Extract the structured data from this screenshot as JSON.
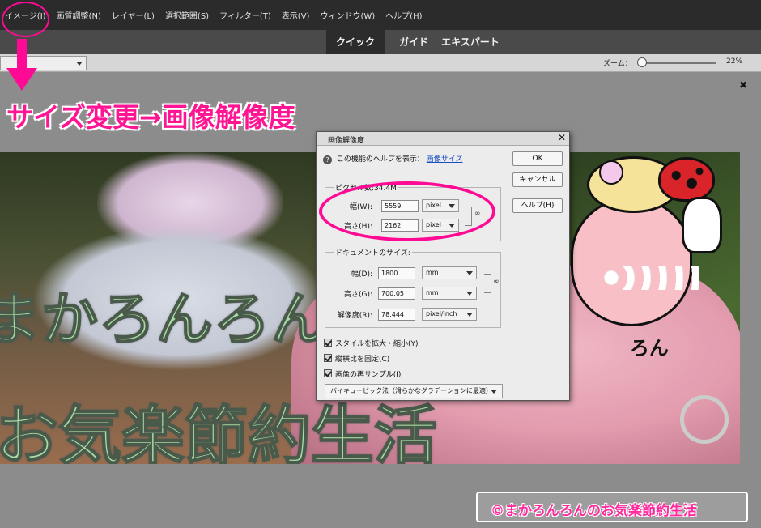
{
  "menu": {
    "items": [
      "イメージ(I)",
      "画質調整(N)",
      "レイヤー(L)",
      "選択範囲(S)",
      "フィルター(T)",
      "表示(V)",
      "ウィンドウ(W)",
      "ヘルプ(H)"
    ]
  },
  "modes": {
    "quick": "クイック",
    "guided": "ガイド",
    "expert": "エキスパート",
    "active": "quick"
  },
  "options": {
    "zoom_label": "ズーム：",
    "zoom_value": "22%",
    "zoom_fraction": 0.05
  },
  "annotation": {
    "caption": "サイズ変更→画像解像度",
    "color": "#ff1493"
  },
  "canvas_text": {
    "line1": "まかろんろん",
    "line2": "お気楽節約生活",
    "character_text": "ろん"
  },
  "dialog": {
    "title": "画像解像度",
    "help_text": "この機能のヘルプを表示：",
    "help_link": "画像サイズ",
    "buttons": {
      "ok": "OK",
      "cancel": "キャンセル",
      "help": "ヘルプ(H)"
    },
    "pixel_group": {
      "label": "ピクセル数:34.4M",
      "width_label": "幅(W):",
      "width_value": "5559",
      "width_unit": "pixel",
      "height_label": "高さ(H):",
      "height_value": "2162",
      "height_unit": "pixel"
    },
    "doc_group": {
      "label": "ドキュメントのサイズ:",
      "width_label": "幅(D):",
      "width_value": "1800",
      "width_unit": "mm",
      "height_label": "高さ(G):",
      "height_value": "700.05",
      "height_unit": "mm",
      "res_label": "解像度(R):",
      "res_value": "78.444",
      "res_unit": "pixel/inch"
    },
    "checks": {
      "scale_styles": "スタイルを拡大・縮小(Y)",
      "constrain": "縦横比を固定(C)",
      "resample": "画像の再サンプル(I)"
    },
    "resample_method": "バイキュービック法（滑らかなグラデーションに最適）"
  },
  "watermark": {
    "text": "©まかろんろんのお気楽節約生活"
  }
}
